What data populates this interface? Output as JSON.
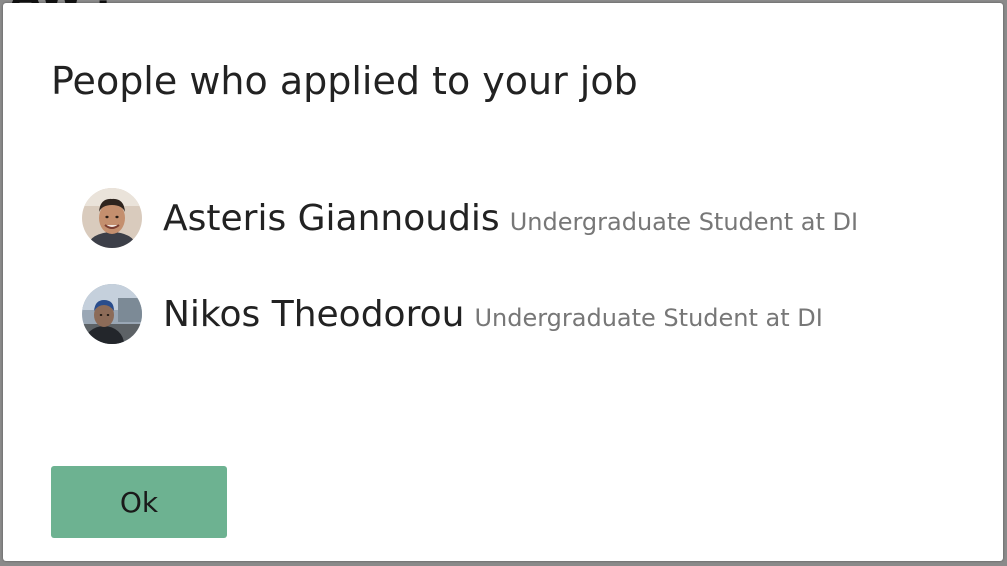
{
  "backdrop": {
    "partial_text": "AW'.'",
    "edge_glyph": ")"
  },
  "modal": {
    "title": "People who applied to your job",
    "applicants": [
      {
        "name": "Asteris Giannoudis",
        "role": "Undergraduate Student at DI",
        "avatar": "profile-photo-man-smiling"
      },
      {
        "name": "Nikos Theodorou",
        "role": "Undergraduate Student at DI",
        "avatar": "profile-photo-man-outdoors"
      }
    ],
    "ok_label": "Ok"
  },
  "colors": {
    "ok_button": "#6db291",
    "title_text": "#222222",
    "role_text": "#777777",
    "backdrop": "#8a8a8a"
  }
}
